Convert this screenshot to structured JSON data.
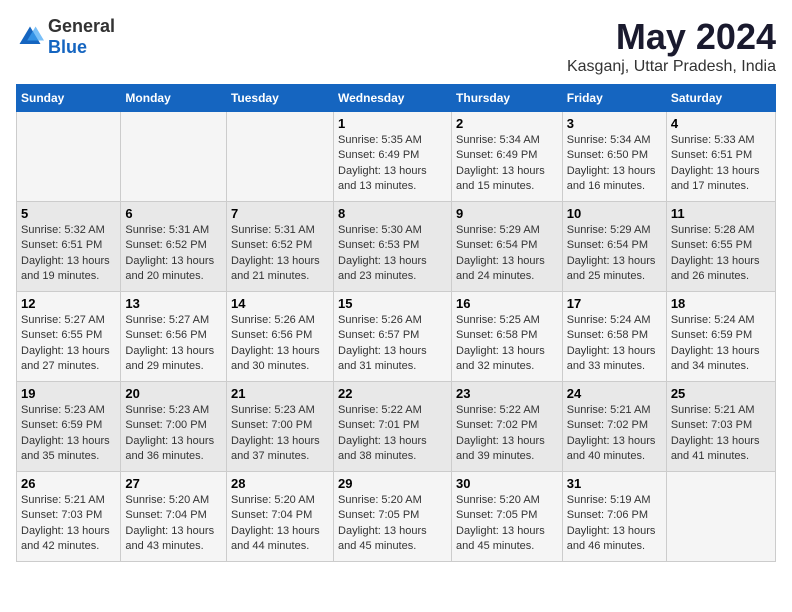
{
  "header": {
    "logo_general": "General",
    "logo_blue": "Blue",
    "month_title": "May 2024",
    "location": "Kasganj, Uttar Pradesh, India"
  },
  "days_of_week": [
    "Sunday",
    "Monday",
    "Tuesday",
    "Wednesday",
    "Thursday",
    "Friday",
    "Saturday"
  ],
  "weeks": [
    [
      {
        "day": "",
        "sunrise": "",
        "sunset": "",
        "daylight": ""
      },
      {
        "day": "",
        "sunrise": "",
        "sunset": "",
        "daylight": ""
      },
      {
        "day": "",
        "sunrise": "",
        "sunset": "",
        "daylight": ""
      },
      {
        "day": "1",
        "sunrise": "Sunrise: 5:35 AM",
        "sunset": "Sunset: 6:49 PM",
        "daylight": "Daylight: 13 hours and 13 minutes."
      },
      {
        "day": "2",
        "sunrise": "Sunrise: 5:34 AM",
        "sunset": "Sunset: 6:49 PM",
        "daylight": "Daylight: 13 hours and 15 minutes."
      },
      {
        "day": "3",
        "sunrise": "Sunrise: 5:34 AM",
        "sunset": "Sunset: 6:50 PM",
        "daylight": "Daylight: 13 hours and 16 minutes."
      },
      {
        "day": "4",
        "sunrise": "Sunrise: 5:33 AM",
        "sunset": "Sunset: 6:51 PM",
        "daylight": "Daylight: 13 hours and 17 minutes."
      }
    ],
    [
      {
        "day": "5",
        "sunrise": "Sunrise: 5:32 AM",
        "sunset": "Sunset: 6:51 PM",
        "daylight": "Daylight: 13 hours and 19 minutes."
      },
      {
        "day": "6",
        "sunrise": "Sunrise: 5:31 AM",
        "sunset": "Sunset: 6:52 PM",
        "daylight": "Daylight: 13 hours and 20 minutes."
      },
      {
        "day": "7",
        "sunrise": "Sunrise: 5:31 AM",
        "sunset": "Sunset: 6:52 PM",
        "daylight": "Daylight: 13 hours and 21 minutes."
      },
      {
        "day": "8",
        "sunrise": "Sunrise: 5:30 AM",
        "sunset": "Sunset: 6:53 PM",
        "daylight": "Daylight: 13 hours and 23 minutes."
      },
      {
        "day": "9",
        "sunrise": "Sunrise: 5:29 AM",
        "sunset": "Sunset: 6:54 PM",
        "daylight": "Daylight: 13 hours and 24 minutes."
      },
      {
        "day": "10",
        "sunrise": "Sunrise: 5:29 AM",
        "sunset": "Sunset: 6:54 PM",
        "daylight": "Daylight: 13 hours and 25 minutes."
      },
      {
        "day": "11",
        "sunrise": "Sunrise: 5:28 AM",
        "sunset": "Sunset: 6:55 PM",
        "daylight": "Daylight: 13 hours and 26 minutes."
      }
    ],
    [
      {
        "day": "12",
        "sunrise": "Sunrise: 5:27 AM",
        "sunset": "Sunset: 6:55 PM",
        "daylight": "Daylight: 13 hours and 27 minutes."
      },
      {
        "day": "13",
        "sunrise": "Sunrise: 5:27 AM",
        "sunset": "Sunset: 6:56 PM",
        "daylight": "Daylight: 13 hours and 29 minutes."
      },
      {
        "day": "14",
        "sunrise": "Sunrise: 5:26 AM",
        "sunset": "Sunset: 6:56 PM",
        "daylight": "Daylight: 13 hours and 30 minutes."
      },
      {
        "day": "15",
        "sunrise": "Sunrise: 5:26 AM",
        "sunset": "Sunset: 6:57 PM",
        "daylight": "Daylight: 13 hours and 31 minutes."
      },
      {
        "day": "16",
        "sunrise": "Sunrise: 5:25 AM",
        "sunset": "Sunset: 6:58 PM",
        "daylight": "Daylight: 13 hours and 32 minutes."
      },
      {
        "day": "17",
        "sunrise": "Sunrise: 5:24 AM",
        "sunset": "Sunset: 6:58 PM",
        "daylight": "Daylight: 13 hours and 33 minutes."
      },
      {
        "day": "18",
        "sunrise": "Sunrise: 5:24 AM",
        "sunset": "Sunset: 6:59 PM",
        "daylight": "Daylight: 13 hours and 34 minutes."
      }
    ],
    [
      {
        "day": "19",
        "sunrise": "Sunrise: 5:23 AM",
        "sunset": "Sunset: 6:59 PM",
        "daylight": "Daylight: 13 hours and 35 minutes."
      },
      {
        "day": "20",
        "sunrise": "Sunrise: 5:23 AM",
        "sunset": "Sunset: 7:00 PM",
        "daylight": "Daylight: 13 hours and 36 minutes."
      },
      {
        "day": "21",
        "sunrise": "Sunrise: 5:23 AM",
        "sunset": "Sunset: 7:00 PM",
        "daylight": "Daylight: 13 hours and 37 minutes."
      },
      {
        "day": "22",
        "sunrise": "Sunrise: 5:22 AM",
        "sunset": "Sunset: 7:01 PM",
        "daylight": "Daylight: 13 hours and 38 minutes."
      },
      {
        "day": "23",
        "sunrise": "Sunrise: 5:22 AM",
        "sunset": "Sunset: 7:02 PM",
        "daylight": "Daylight: 13 hours and 39 minutes."
      },
      {
        "day": "24",
        "sunrise": "Sunrise: 5:21 AM",
        "sunset": "Sunset: 7:02 PM",
        "daylight": "Daylight: 13 hours and 40 minutes."
      },
      {
        "day": "25",
        "sunrise": "Sunrise: 5:21 AM",
        "sunset": "Sunset: 7:03 PM",
        "daylight": "Daylight: 13 hours and 41 minutes."
      }
    ],
    [
      {
        "day": "26",
        "sunrise": "Sunrise: 5:21 AM",
        "sunset": "Sunset: 7:03 PM",
        "daylight": "Daylight: 13 hours and 42 minutes."
      },
      {
        "day": "27",
        "sunrise": "Sunrise: 5:20 AM",
        "sunset": "Sunset: 7:04 PM",
        "daylight": "Daylight: 13 hours and 43 minutes."
      },
      {
        "day": "28",
        "sunrise": "Sunrise: 5:20 AM",
        "sunset": "Sunset: 7:04 PM",
        "daylight": "Daylight: 13 hours and 44 minutes."
      },
      {
        "day": "29",
        "sunrise": "Sunrise: 5:20 AM",
        "sunset": "Sunset: 7:05 PM",
        "daylight": "Daylight: 13 hours and 45 minutes."
      },
      {
        "day": "30",
        "sunrise": "Sunrise: 5:20 AM",
        "sunset": "Sunset: 7:05 PM",
        "daylight": "Daylight: 13 hours and 45 minutes."
      },
      {
        "day": "31",
        "sunrise": "Sunrise: 5:19 AM",
        "sunset": "Sunset: 7:06 PM",
        "daylight": "Daylight: 13 hours and 46 minutes."
      },
      {
        "day": "",
        "sunrise": "",
        "sunset": "",
        "daylight": ""
      }
    ]
  ]
}
